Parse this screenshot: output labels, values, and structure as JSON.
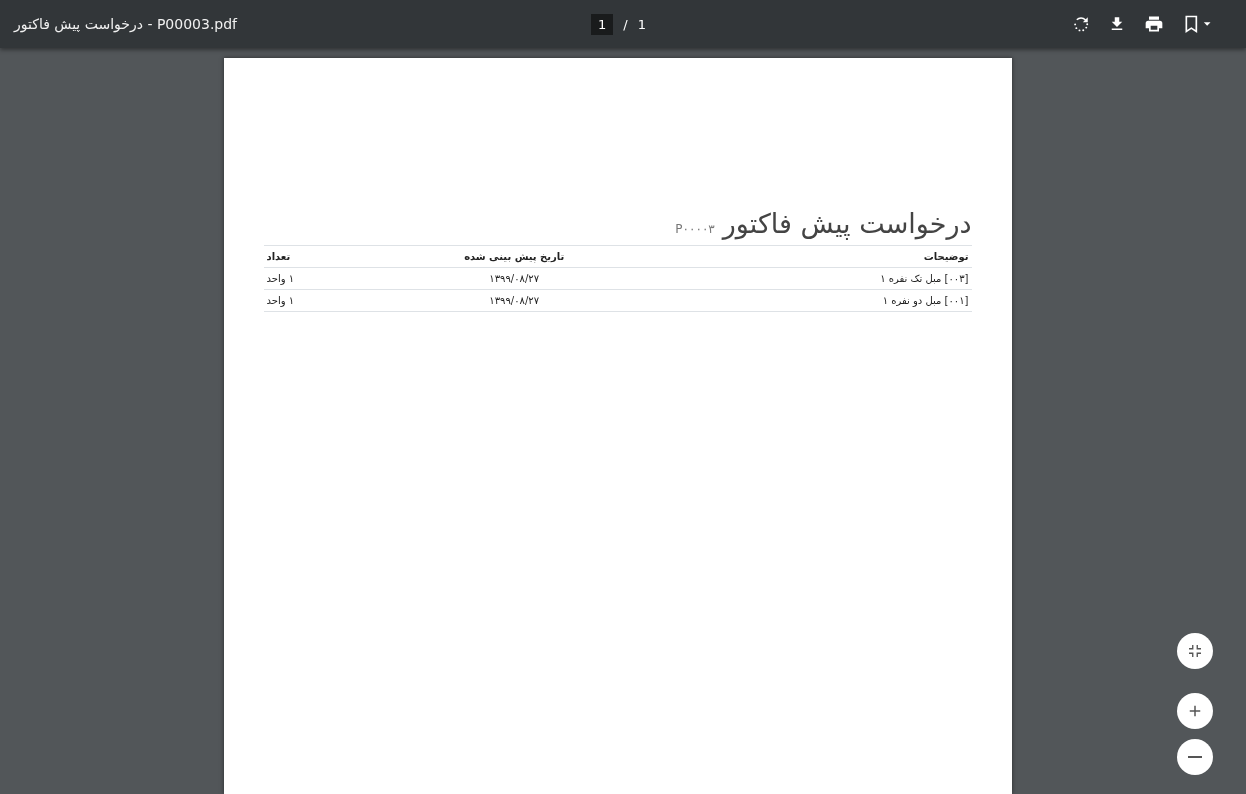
{
  "toolbar": {
    "title": "درخواست پیش فاکتور - P00003.pdf",
    "page_current": "1",
    "page_separator": "/",
    "page_total": "1"
  },
  "document": {
    "heading": "درخواست پیش فاکتور",
    "reference": "P۰۰۰۰۳",
    "table": {
      "columns": [
        "توضیحات",
        "تاریخ پیش بینی شده",
        "تعداد"
      ],
      "rows": [
        [
          "[۰۰۳] مبل تک نفره ۱",
          "۱۳۹۹/۰۸/۲۷",
          "۱ واحد"
        ],
        [
          "[۰۰۱] مبل دو نفره ۱",
          "۱۳۹۹/۰۸/۲۷",
          "۱ واحد"
        ]
      ]
    }
  }
}
